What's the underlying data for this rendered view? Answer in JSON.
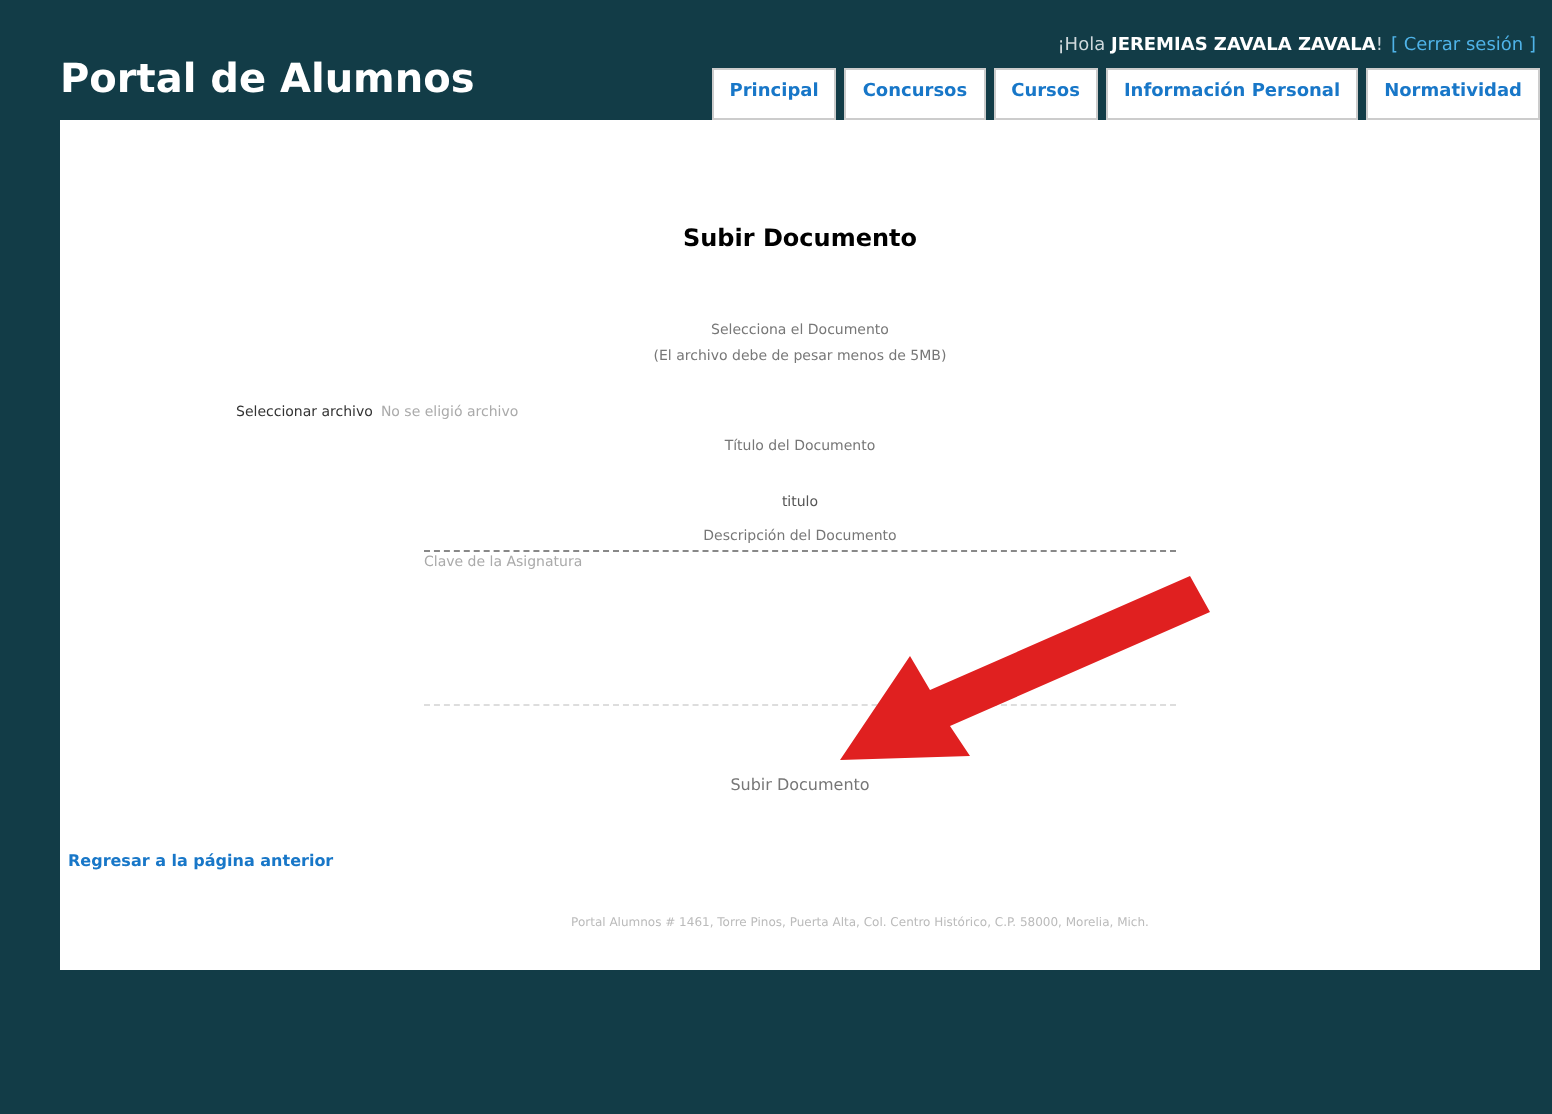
{
  "header": {
    "title": "Portal de Alumnos",
    "greeting_prefix": "¡Hola ",
    "user_name": "JEREMIAS ZAVALA ZAVALA",
    "greeting_suffix": "!",
    "logout": "[ Cerrar sesión ]"
  },
  "tabs": [
    {
      "label": "Principal",
      "selected": false
    },
    {
      "label": "Concursos",
      "selected": false
    },
    {
      "label": "Cursos",
      "selected": false
    },
    {
      "label": "Información Personal",
      "selected": false
    },
    {
      "label": "Normatividad",
      "selected": false
    }
  ],
  "form": {
    "heading": "Subir Documento",
    "file_label": "Selecciona el Documento",
    "file_note": "(El archivo debe de pesar menos de 5MB)",
    "file_button": "Seleccionar archivo",
    "file_status": "No se eligió archivo",
    "title_label": "Título del Documento",
    "title_value": "titulo",
    "description_label": "Descripción del Documento",
    "description_placeholder": "Clave de la Asignatura",
    "submit": "Subir Documento"
  },
  "back_link": "Regresar a la página anterior",
  "footer": "Portal Alumnos # 1461, Torre Pinos, Puerta Alta, Col. Centro Histórico, C.P. 58000, Morelia, Mich."
}
